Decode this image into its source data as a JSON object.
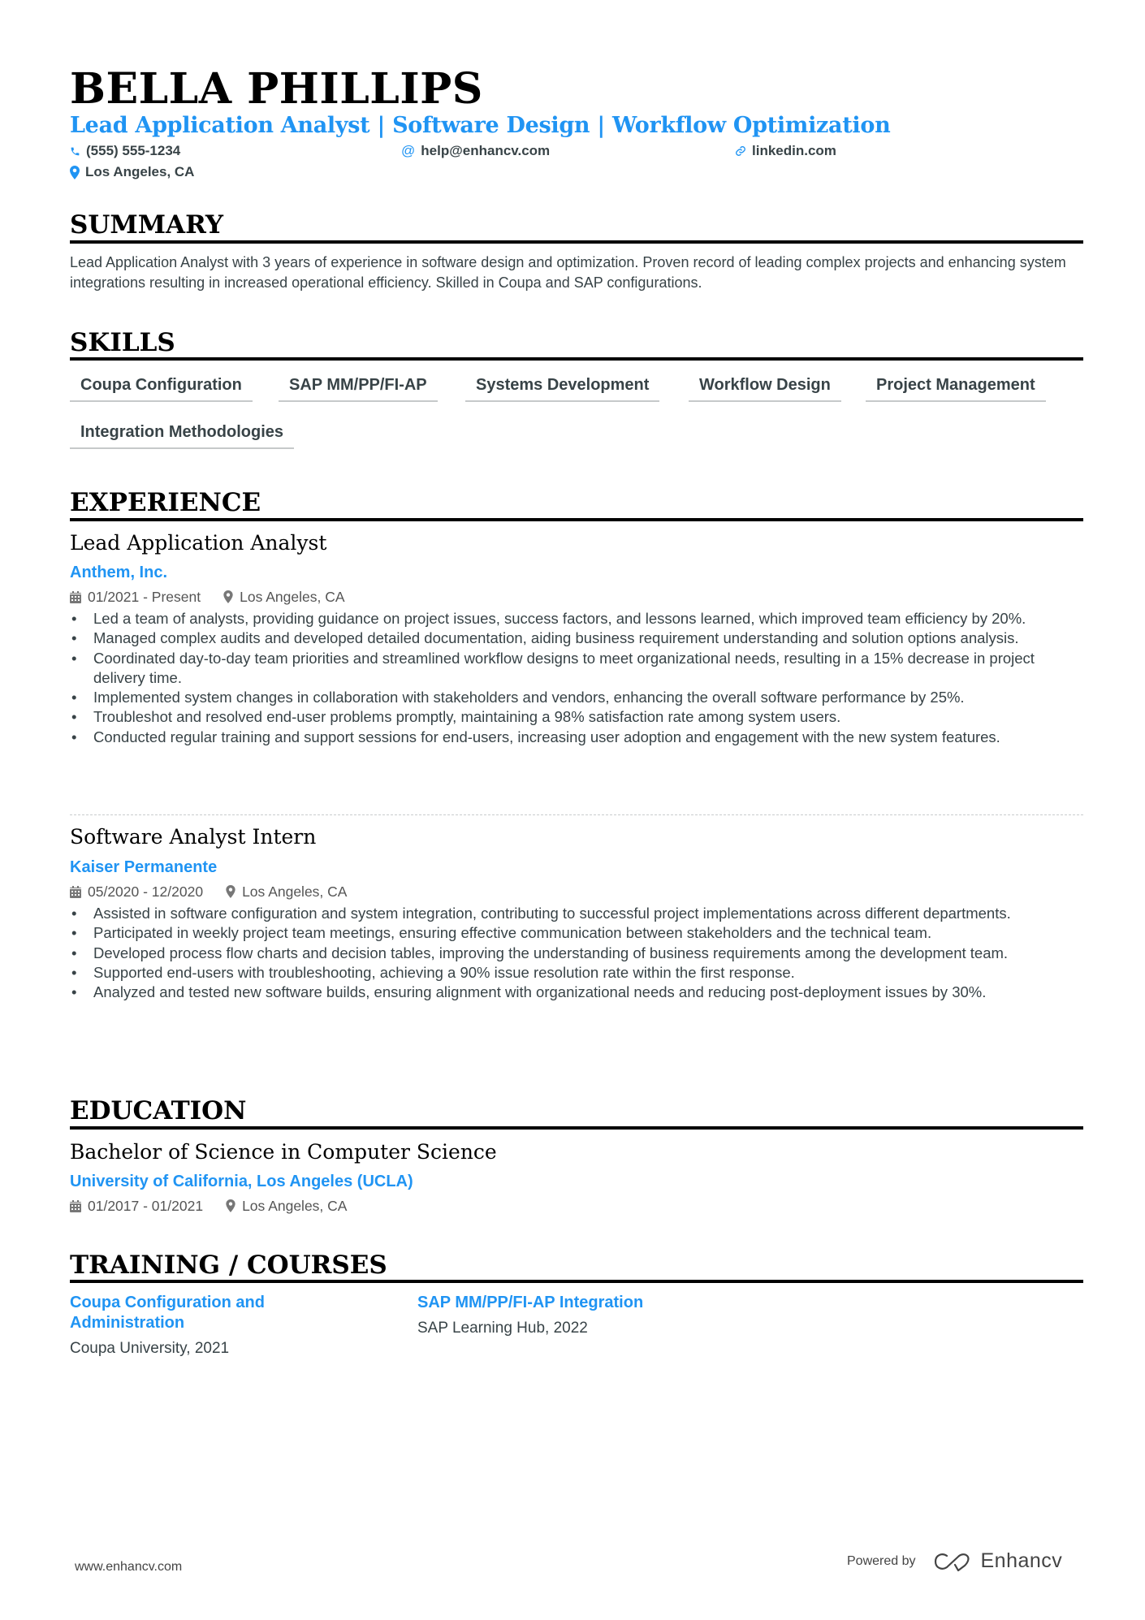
{
  "header": {
    "name": "BELLA PHILLIPS",
    "subtitle": "Lead Application Analyst | Software Design | Workflow Optimization",
    "contacts": {
      "phone": {
        "icon": "phone-icon",
        "text": "(555) 555-1234"
      },
      "email": {
        "icon": "at-icon",
        "text": "help@enhancv.com"
      },
      "linkedin": {
        "icon": "link-icon",
        "text": "linkedin.com"
      },
      "location": {
        "icon": "map-pin-icon",
        "text": "Los Angeles, CA"
      }
    }
  },
  "colors": {
    "accent": "#2094f3",
    "text": "#384347",
    "heading": "#000000"
  },
  "summary": {
    "title": "SUMMARY",
    "text": "Lead Application Analyst with 3 years of experience in software design and optimization. Proven record of leading complex projects and enhancing system integrations resulting in increased operational efficiency. Skilled in Coupa and SAP configurations."
  },
  "skills": {
    "title": "SKILLS",
    "items": [
      "Coupa Configuration",
      "SAP MM/PP/FI-AP",
      "Systems Development",
      "Workflow Design",
      "Project Management",
      "Integration Methodologies"
    ]
  },
  "experience": {
    "title": "EXPERIENCE",
    "jobs": [
      {
        "title": "Lead Application Analyst",
        "company": "Anthem, Inc.",
        "dates": "01/2021 - Present",
        "location": "Los Angeles, CA",
        "bullets": [
          "Led a team of analysts, providing guidance on project issues, success factors, and lessons learned, which improved team efficiency by 20%.",
          "Managed complex audits and developed detailed documentation, aiding business requirement understanding and solution options analysis.",
          "Coordinated day-to-day team priorities and streamlined workflow designs to meet organizational needs, resulting in a 15% decrease in project delivery time.",
          "Implemented system changes in collaboration with stakeholders and vendors, enhancing the overall software performance by 25%.",
          "Troubleshot and resolved end-user problems promptly, maintaining a 98% satisfaction rate among system users.",
          "Conducted regular training and support sessions for end-users, increasing user adoption and engagement with the new system features."
        ]
      },
      {
        "title": "Software Analyst Intern",
        "company": "Kaiser Permanente",
        "dates": "05/2020 - 12/2020",
        "location": "Los Angeles, CA",
        "bullets": [
          "Assisted in software configuration and system integration, contributing to successful project implementations across different departments.",
          "Participated in weekly project team meetings, ensuring effective communication between stakeholders and the technical team.",
          "Developed process flow charts and decision tables, improving the understanding of business requirements among the development team.",
          "Supported end-users with troubleshooting, achieving a 90% issue resolution rate within the first response.",
          "Analyzed and tested new software builds, ensuring alignment with organizational needs and reducing post-deployment issues by 30%."
        ]
      }
    ]
  },
  "education": {
    "title": "EDUCATION",
    "degree": "Bachelor of Science in Computer Science",
    "school": "University of California, Los Angeles (UCLA)",
    "dates": "01/2017 - 01/2021",
    "location": "Los Angeles, CA"
  },
  "training": {
    "title": "TRAINING / COURSES",
    "courses": [
      {
        "title": "Coupa Configuration and Administration",
        "provider": "Coupa University, 2021"
      },
      {
        "title": "SAP MM/PP/FI-AP Integration",
        "provider": "SAP Learning Hub, 2022"
      }
    ]
  },
  "footer": {
    "website": "www.enhancv.com",
    "powered_by": "Powered by",
    "brand": "Enhancv"
  }
}
